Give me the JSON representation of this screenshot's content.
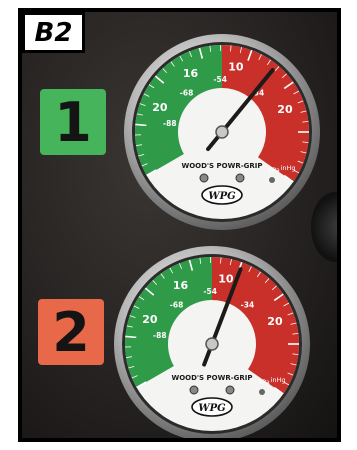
{
  "figure_tag": "B2",
  "badges": [
    {
      "label": "1",
      "color": "#45b45a"
    },
    {
      "label": "2",
      "color": "#e8694a"
    }
  ],
  "gauges": [
    {
      "brand": "WOOD'S POWR-GRIP",
      "logo": "WPG",
      "units": [
        "kPa",
        "inHg"
      ],
      "outer_labels": [
        "20",
        "16",
        "10",
        "20"
      ],
      "inner_labels": [
        "-68",
        "-54",
        "-34",
        "-88"
      ],
      "needle_value": "13",
      "colors": {
        "green": "#2f9a48",
        "red": "#c9302a",
        "dial": "#f4f4f2"
      }
    },
    {
      "brand": "WOOD'S POWR-GRIP",
      "logo": "WPG",
      "units": [
        "kPa",
        "inHg"
      ],
      "outer_labels": [
        "20",
        "16",
        "10",
        "20"
      ],
      "inner_labels": [
        "-68",
        "-54",
        "-34",
        "-88"
      ],
      "needle_value": "11.5",
      "colors": {
        "green": "#2f9a48",
        "red": "#c9302a",
        "dial": "#f4f4f2"
      }
    }
  ]
}
